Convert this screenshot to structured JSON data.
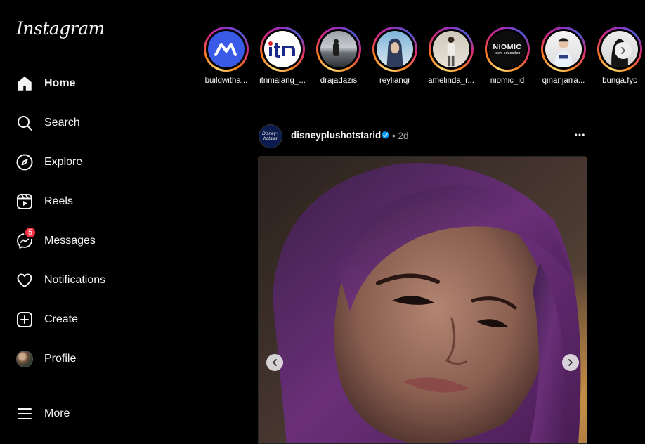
{
  "app": {
    "logo_text": "Instagram"
  },
  "sidebar": {
    "items": [
      {
        "label": "Home",
        "icon": "home-icon",
        "active": true
      },
      {
        "label": "Search",
        "icon": "search-icon"
      },
      {
        "label": "Explore",
        "icon": "compass-icon"
      },
      {
        "label": "Reels",
        "icon": "reels-icon"
      },
      {
        "label": "Messages",
        "icon": "messenger-icon",
        "badge": "5"
      },
      {
        "label": "Notifications",
        "icon": "heart-icon"
      },
      {
        "label": "Create",
        "icon": "plus-square-icon"
      },
      {
        "label": "Profile",
        "icon": "avatar"
      }
    ],
    "more_label": "More"
  },
  "stories": [
    {
      "name": "buildwitha..."
    },
    {
      "name": "itnmalang_..."
    },
    {
      "name": "drajadazis"
    },
    {
      "name": "reylianqr"
    },
    {
      "name": "amelinda_r..."
    },
    {
      "name": "niomic_id",
      "logo_text": "NIOMIC",
      "logo_subtext": "tech. education"
    },
    {
      "name": "qinanjarra..."
    },
    {
      "name": "bunga.fyc"
    }
  ],
  "post": {
    "username": "disneyplushotstarid",
    "separator": "•",
    "time": "2d",
    "avatar_text": "Disney+ hotstar"
  },
  "colors": {
    "background": "#000000",
    "text": "#f5f5f5",
    "muted": "#a8a8a8",
    "badge": "#ff3040",
    "verified": "#0095f6"
  }
}
